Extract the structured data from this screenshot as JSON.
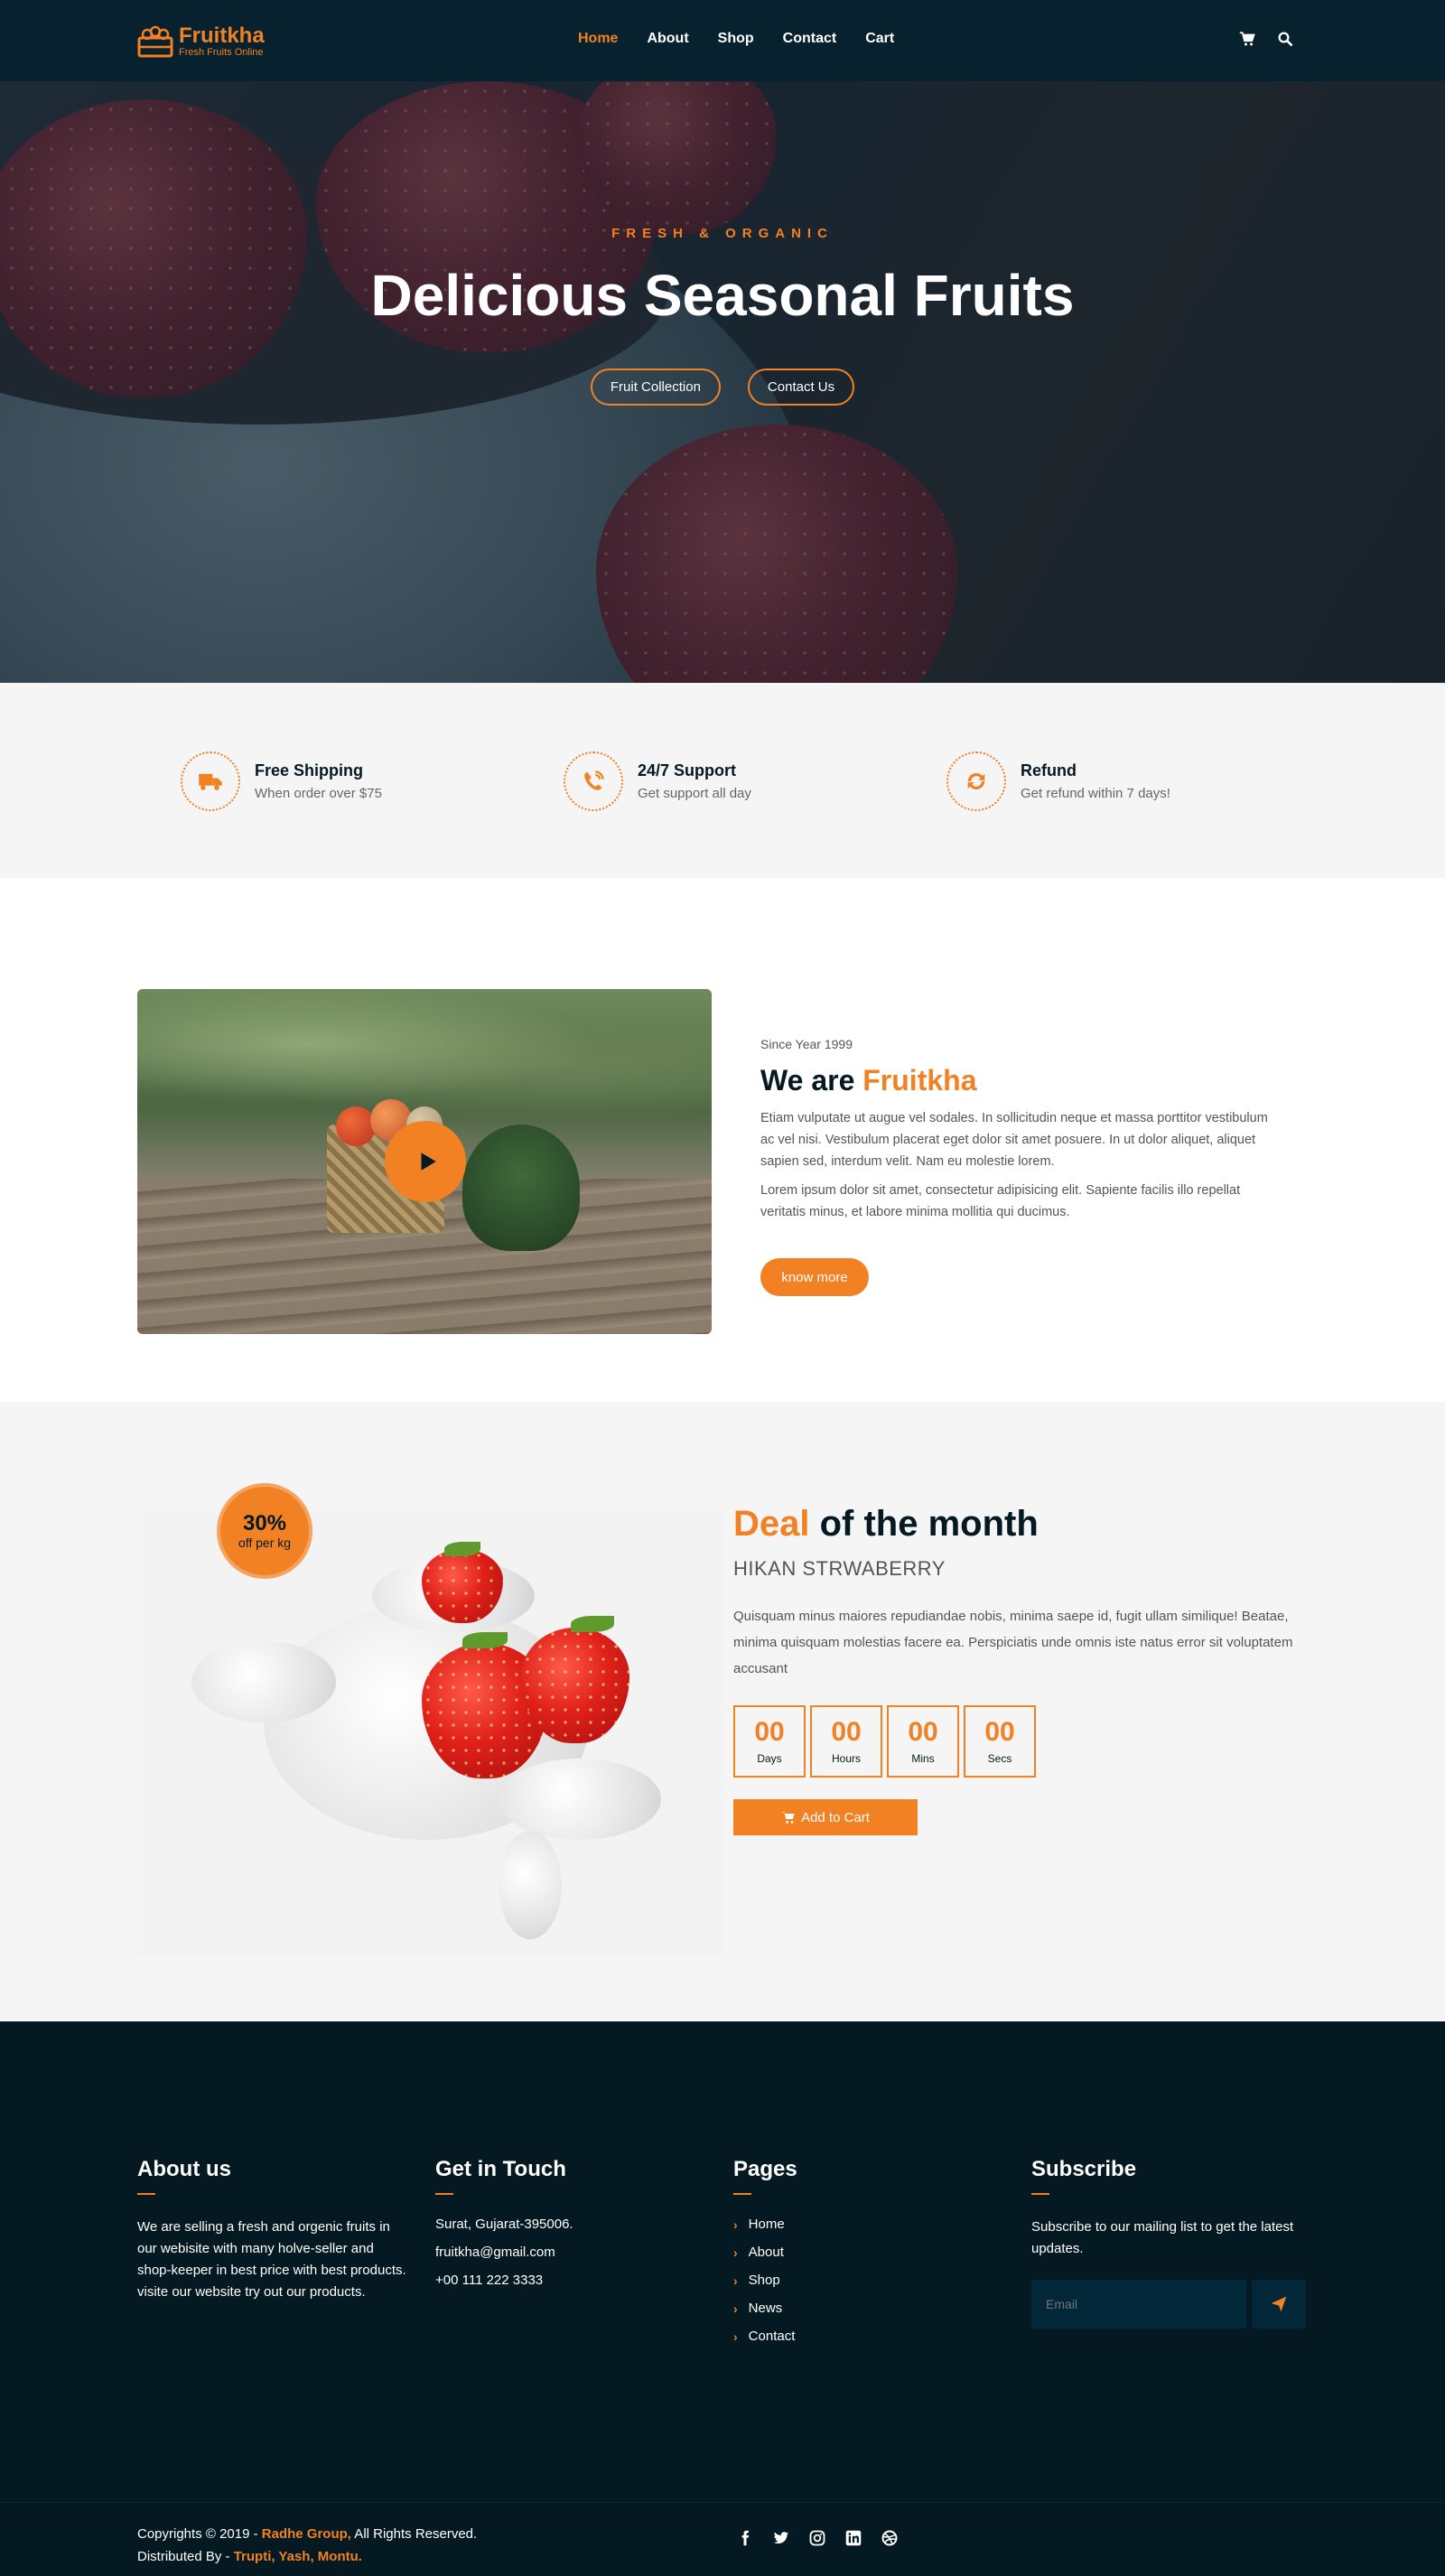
{
  "brand": {
    "name": "Fruitkha",
    "tagline": "Fresh Fruits Online",
    "accent": "#f28123",
    "dark": "#051922"
  },
  "nav": {
    "items": [
      "Home",
      "About",
      "Shop",
      "Contact",
      "Cart"
    ],
    "active": "Home",
    "icons": [
      "cart-icon",
      "search-icon"
    ]
  },
  "hero": {
    "subtitle": "FRESH & ORGANIC",
    "title": "Delicious Seasonal Fruits",
    "buttons": [
      "Fruit Collection",
      "Contact Us"
    ]
  },
  "features": [
    {
      "icon": "shipping-icon",
      "title": "Free Shipping",
      "desc": "When order over $75"
    },
    {
      "icon": "phone-volume-icon",
      "title": "24/7 Support",
      "desc": "Get support all day"
    },
    {
      "icon": "refund-icon",
      "title": "Refund",
      "desc": "Get refund within 7 days!"
    }
  ],
  "about": {
    "since": "Since Year 1999",
    "title_prefix": "We are ",
    "title_brand": "Fruitkha",
    "p1": "Etiam vulputate ut augue vel sodales. In sollicitudin neque et massa porttitor vestibulum ac vel nisi. Vestibulum placerat eget dolor sit amet posuere. In ut dolor aliquet, aliquet sapien sed, interdum velit. Nam eu molestie lorem.",
    "p2": "Lorem ipsum dolor sit amet, consectetur adipisicing elit. Sapiente facilis illo repellat veritatis minus, et labore minima mollitia qui ducimus.",
    "button": "know more"
  },
  "deal": {
    "badge_value": "30%",
    "badge_text": "off per kg",
    "title_highlight": "Deal",
    "title_rest": " of the month",
    "product": "HIKAN STRWABERRY",
    "description": "Quisquam minus maiores repudiandae nobis, minima saepe id, fugit ullam similique! Beatae, minima quisquam molestias facere ea. Perspiciatis unde omnis iste natus error sit voluptatem accusant",
    "timer": [
      {
        "value": "00",
        "label": "Days"
      },
      {
        "value": "00",
        "label": "Hours"
      },
      {
        "value": "00",
        "label": "Mins"
      },
      {
        "value": "00",
        "label": "Secs"
      }
    ],
    "button": "Add to Cart"
  },
  "footer": {
    "about": {
      "heading": "About us",
      "text": "We are selling a fresh and orgenic fruits in our webisite with many holve-seller and shop-keeper in best price with best products. visite our website try out our products."
    },
    "contact": {
      "heading": "Get in Touch",
      "lines": [
        "Surat, Gujarat-395006.",
        "fruitkha@gmail.com",
        "+00 111 222 3333"
      ]
    },
    "pages": {
      "heading": "Pages",
      "links": [
        "Home",
        "About",
        "Shop",
        "News",
        "Contact"
      ]
    },
    "subscribe": {
      "heading": "Subscribe",
      "text": "Subscribe to our mailing list to get the latest updates.",
      "placeholder": "Email"
    }
  },
  "bottom": {
    "copy_prefix": "Copyrights © 2019 - ",
    "copy_company": "Radhe Group,",
    "copy_suffix": " All Rights Reserved.",
    "dist_prefix": "Distributed By - ",
    "dist_names": "Trupti, Yash, Montu.",
    "socials": [
      "facebook-icon",
      "twitter-icon",
      "instagram-icon",
      "linkedin-icon",
      "dribbble-icon"
    ]
  }
}
